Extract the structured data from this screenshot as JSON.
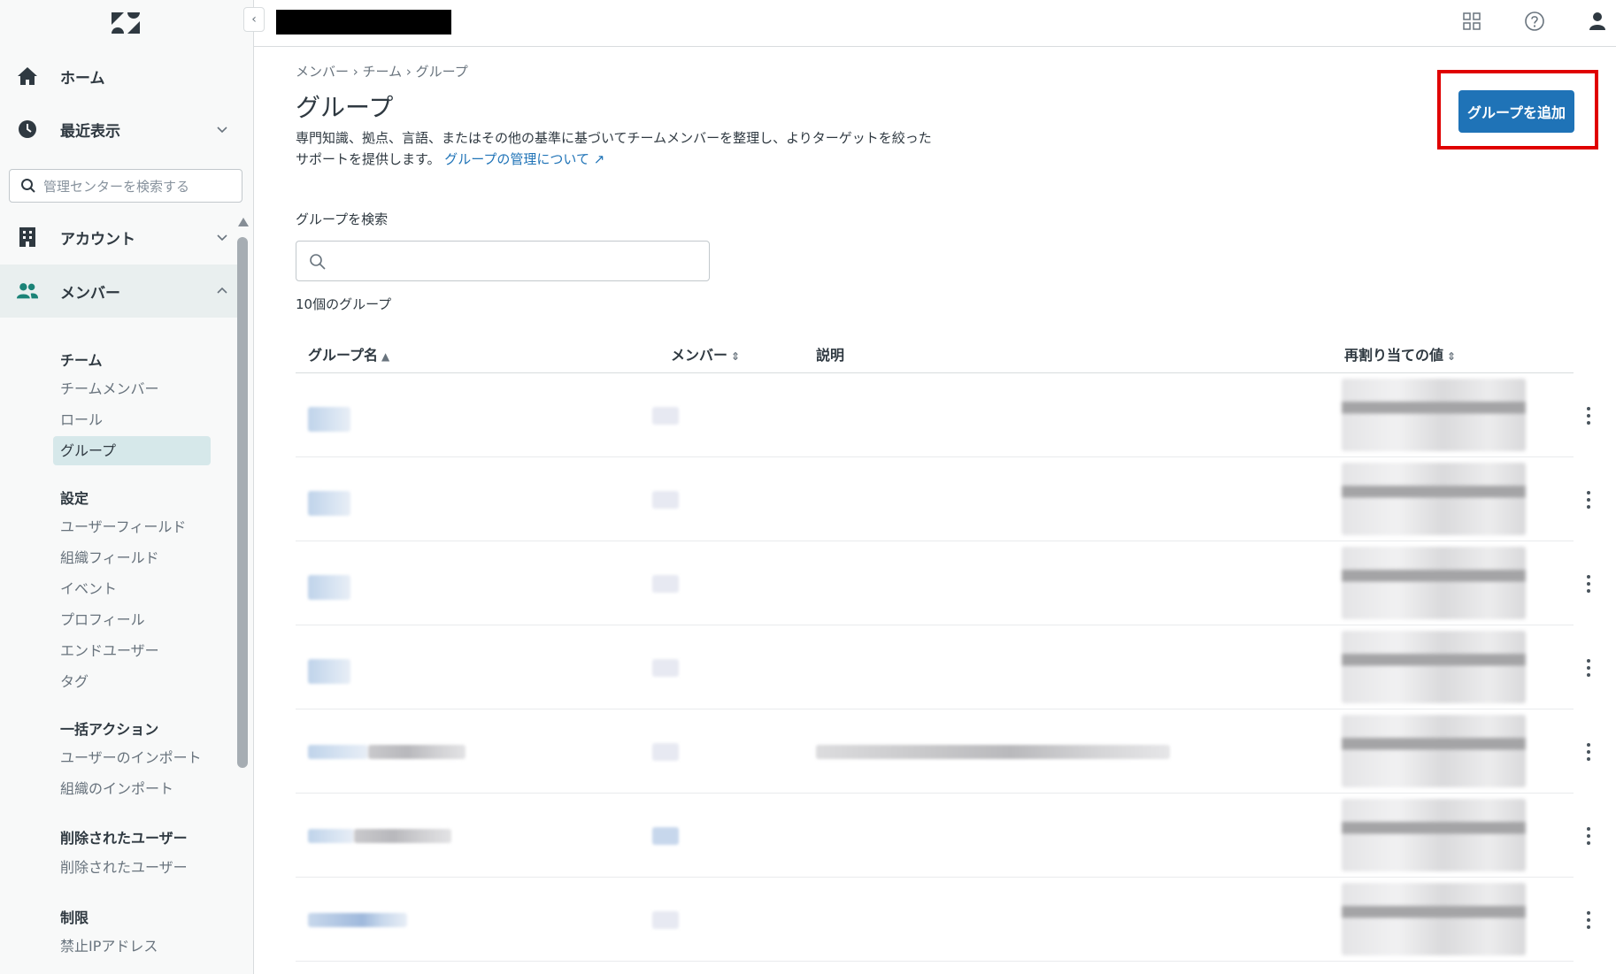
{
  "header": {
    "help_icon": "question-circle-icon",
    "apps_icon": "grid-icon",
    "user_icon": "user-icon"
  },
  "sidebar": {
    "home": "ホーム",
    "recent": "最近表示",
    "search_placeholder": "管理センターを検索する",
    "account": "アカウント",
    "members": "メンバー",
    "team_head": "チーム",
    "team_items": [
      "チームメンバー",
      "ロール",
      "グループ"
    ],
    "settings_head": "設定",
    "settings_items": [
      "ユーザーフィールド",
      "組織フィールド",
      "イベント",
      "プロフィール",
      "エンドユーザー",
      "タグ"
    ],
    "bulk_head": "一括アクション",
    "bulk_items": [
      "ユーザーのインポート",
      "組織のインポート"
    ],
    "deleted_head": "削除されたユーザー",
    "deleted_items": [
      "削除されたユーザー"
    ],
    "limits_head": "制限",
    "limits_items": [
      "禁止IPアドレス"
    ]
  },
  "main": {
    "breadcrumb": "メンバー › チーム › グループ",
    "title": "グループ",
    "description": "専門知識、拠点、言語、またはその他の基準に基づいてチームメンバーを整理し、よりターゲットを絞ったサポートを提供します。",
    "learn_more": "グループの管理について",
    "add_button": "グループを追加",
    "search_label": "グループを検索",
    "count": "10個のグループ",
    "columns": {
      "name": "グループ名",
      "members": "メンバー",
      "description": "説明",
      "reassign": "再割り当ての値"
    }
  },
  "colors": {
    "accent": "#1f73b7",
    "highlight_frame": "#e00000",
    "selected_nav": "#d6e8ea"
  }
}
